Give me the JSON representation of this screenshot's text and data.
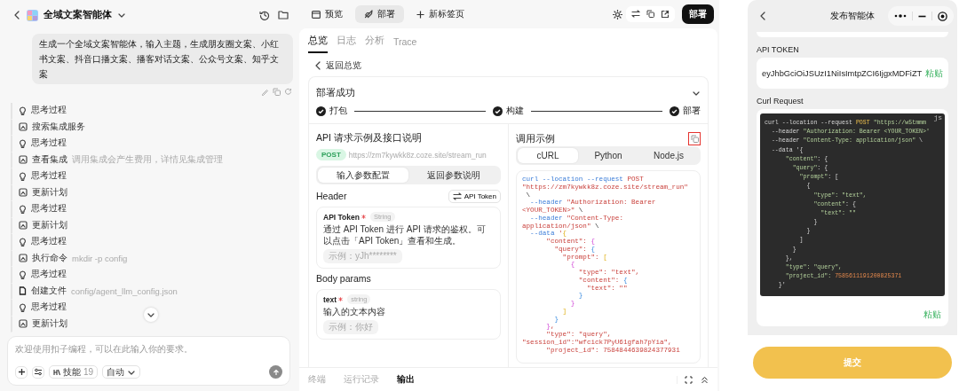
{
  "left": {
    "title": "全域文案智能体",
    "message": "生成一个全域文案智能体，输入主题，生成朋友圈文案、小红书文案、抖音口播文案、播客对话文案、公众号文案、知乎文案",
    "steps": [
      {
        "kind": "think",
        "label": "思考过程"
      },
      {
        "kind": "tool",
        "label": "搜索集成服务"
      },
      {
        "kind": "think",
        "label": "思考过程"
      },
      {
        "kind": "tool",
        "label": "查看集成",
        "detail": "调用集成会产生费用，详情见集成管理"
      },
      {
        "kind": "think",
        "label": "思考过程"
      },
      {
        "kind": "tool",
        "label": "更新计划"
      },
      {
        "kind": "think",
        "label": "思考过程"
      },
      {
        "kind": "tool",
        "label": "更新计划"
      },
      {
        "kind": "think",
        "label": "思考过程"
      },
      {
        "kind": "tool",
        "label": "执行命令",
        "detail": "mkdir -p config"
      },
      {
        "kind": "think",
        "label": "思考过程"
      },
      {
        "kind": "file",
        "label": "创建文件",
        "detail": "config/agent_llm_config.json"
      },
      {
        "kind": "think",
        "label": "思考过程"
      },
      {
        "kind": "tool",
        "label": "更新计划"
      }
    ],
    "input": {
      "placeholder": "欢迎使用扣子编程，可以在此输入你的要求。"
    },
    "skills": {
      "label": "技能",
      "count": "19"
    },
    "mode": "自动"
  },
  "middle": {
    "tabs": [
      {
        "kind": "preview",
        "label": "预览",
        "selected": false
      },
      {
        "kind": "deploy",
        "label": "部署",
        "selected": true
      },
      {
        "kind": "new",
        "label": "新标签页",
        "selected": false
      }
    ],
    "deploy_button": "部署",
    "subtabs": [
      {
        "label": "总览",
        "selected": true
      },
      {
        "label": "日志",
        "selected": false
      },
      {
        "label": "分析",
        "selected": false
      },
      {
        "label": "Trace",
        "selected": false
      }
    ],
    "back": "返回总览",
    "status": {
      "title": "部署成功",
      "stages": [
        {
          "label": "打包",
          "done": true
        },
        {
          "label": "构建",
          "done": true
        },
        {
          "label": "部署",
          "done": true
        }
      ]
    },
    "api": {
      "title": "API 请求示例及接口说明",
      "method": "POST",
      "url": "https://zm7kywkk8z.coze.site/stream_run",
      "segments": [
        {
          "label": "输入参数配置",
          "selected": true
        },
        {
          "label": "返回参数说明",
          "selected": false
        }
      ],
      "header_title": "Header",
      "token_button": "API Token",
      "header_params": [
        {
          "name": "API Token",
          "required": true,
          "type": "String",
          "description": "通过 API Token 进行 API 请求的鉴权。可以点击「API Token」查看和生成。",
          "example": "示例：yJh********"
        }
      ],
      "body_title": "Body params",
      "body_params": [
        {
          "name": "text",
          "required": true,
          "type": "string",
          "description": "输入的文本内容",
          "example": "示例：你好"
        }
      ]
    },
    "example": {
      "title": "调用示例",
      "languages": [
        {
          "label": "cURL",
          "selected": true
        },
        {
          "label": "Python",
          "selected": false
        },
        {
          "label": "Node.js",
          "selected": false
        }
      ],
      "code": [
        [
          {
            "kind": "cmd",
            "text": "curl --location --request "
          },
          {
            "kind": "str",
            "text": "POST"
          }
        ],
        [
          {
            "kind": "str",
            "text": "\"https://zm7kywkk8z.coze.site/stream_run\""
          }
        ],
        [
          {
            "kind": "text",
            "text": " \\"
          }
        ],
        [
          {
            "kind": "cmd",
            "text": "  --header "
          },
          {
            "kind": "str",
            "text": "\"Authorization: Bearer"
          }
        ],
        [
          {
            "kind": "str",
            "text": "<YOUR_TOKEN>\""
          },
          {
            "kind": "text",
            "text": " \\"
          }
        ],
        [
          {
            "kind": "cmd",
            "text": "  --header "
          },
          {
            "kind": "str",
            "text": "\"Content-Type:"
          }
        ],
        [
          {
            "kind": "str",
            "text": "application/json\""
          },
          {
            "kind": "text",
            "text": " \\"
          }
        ],
        [
          {
            "kind": "cmd",
            "text": "  --data "
          },
          {
            "kind": "str",
            "text": "'"
          },
          {
            "kind": "b3",
            "text": "{"
          }
        ],
        [
          {
            "kind": "str",
            "text": "      \"content\": "
          },
          {
            "kind": "b1",
            "text": "{"
          }
        ],
        [
          {
            "kind": "str",
            "text": "        \"query\": "
          },
          {
            "kind": "b2",
            "text": "{"
          }
        ],
        [
          {
            "kind": "str",
            "text": "          \"prompt\": "
          },
          {
            "kind": "b3",
            "text": "["
          }
        ],
        [
          {
            "kind": "b1",
            "text": "            {"
          }
        ],
        [
          {
            "kind": "str",
            "text": "              \"type\": \"text\","
          }
        ],
        [
          {
            "kind": "str",
            "text": "              \"content\": "
          },
          {
            "kind": "b2",
            "text": "{"
          }
        ],
        [
          {
            "kind": "str",
            "text": "                \"text\": \"\""
          }
        ],
        [
          {
            "kind": "b2",
            "text": "              }"
          }
        ],
        [
          {
            "kind": "b1",
            "text": "            }"
          }
        ],
        [
          {
            "kind": "b3",
            "text": "          ]"
          }
        ],
        [
          {
            "kind": "b2",
            "text": "        }"
          }
        ],
        [
          {
            "kind": "b1",
            "text": "      }"
          },
          {
            "kind": "str",
            "text": ","
          }
        ],
        [
          {
            "kind": "str",
            "text": "      \"type\": \"query\","
          }
        ],
        [
          {
            "kind": "str",
            "text": "\"session_id\":\"wfcick7PyU61gfah7pYia\","
          }
        ],
        [
          {
            "kind": "str",
            "text": "      \"project_id\": 7584844639824377931"
          }
        ]
      ]
    },
    "bottom_tabs": [
      {
        "label": "终端",
        "selected": false
      },
      {
        "label": "运行记录",
        "selected": false
      },
      {
        "label": "输出",
        "selected": true
      }
    ]
  },
  "phone": {
    "title": "发布智能体",
    "token_label": "API TOKEN",
    "token": "eyJhbGciOiJSUzI1NiIsImtpZCI6IjgxMDFiZT",
    "paste": "粘贴",
    "curl_label": "Curl Request",
    "lang_tag": "js",
    "code": [
      [
        {
          "kind": "text",
          "text": "curl --location --request "
        },
        {
          "kind": "kw",
          "text": "POST"
        },
        {
          "kind": "str",
          "text": " \"https://w5tmmm"
        }
      ],
      [
        {
          "kind": "text",
          "text": "  --header "
        },
        {
          "kind": "str",
          "text": "\"Authorization: Bearer <YOUR_TOKEN>'"
        }
      ],
      [
        {
          "kind": "text",
          "text": "  --header "
        },
        {
          "kind": "str",
          "text": "\"Content-Type: application/json\""
        },
        {
          "kind": "text",
          "text": " \\"
        }
      ],
      [
        {
          "kind": "text",
          "text": "  --data '{"
        }
      ],
      [
        {
          "kind": "str",
          "text": "      \"content\""
        },
        {
          "kind": "text",
          "text": ": {"
        }
      ],
      [
        {
          "kind": "str",
          "text": "        \"query\""
        },
        {
          "kind": "text",
          "text": ": {"
        }
      ],
      [
        {
          "kind": "str",
          "text": "          \"prompt\""
        },
        {
          "kind": "text",
          "text": ": ["
        }
      ],
      [
        {
          "kind": "text",
          "text": "            {"
        }
      ],
      [
        {
          "kind": "str",
          "text": "              \"type\": \"text\","
        }
      ],
      [
        {
          "kind": "str",
          "text": "              \"content\""
        },
        {
          "kind": "text",
          "text": ": {"
        }
      ],
      [
        {
          "kind": "str",
          "text": "                \"text\": \"\""
        }
      ],
      [
        {
          "kind": "text",
          "text": "              }"
        }
      ],
      [
        {
          "kind": "text",
          "text": "            }"
        }
      ],
      [
        {
          "kind": "text",
          "text": "          ]"
        }
      ],
      [
        {
          "kind": "text",
          "text": "        }"
        }
      ],
      [
        {
          "kind": "text",
          "text": "      },"
        }
      ],
      [
        {
          "kind": "str",
          "text": "      \"type\": \"query\","
        }
      ],
      [
        {
          "kind": "str",
          "text": "      \"project_id\": "
        },
        {
          "kind": "num",
          "text": "7585611191200825371"
        }
      ],
      [
        {
          "kind": "text",
          "text": "    }'"
        }
      ]
    ],
    "paste_bottom": "粘贴",
    "submit": "提交"
  }
}
